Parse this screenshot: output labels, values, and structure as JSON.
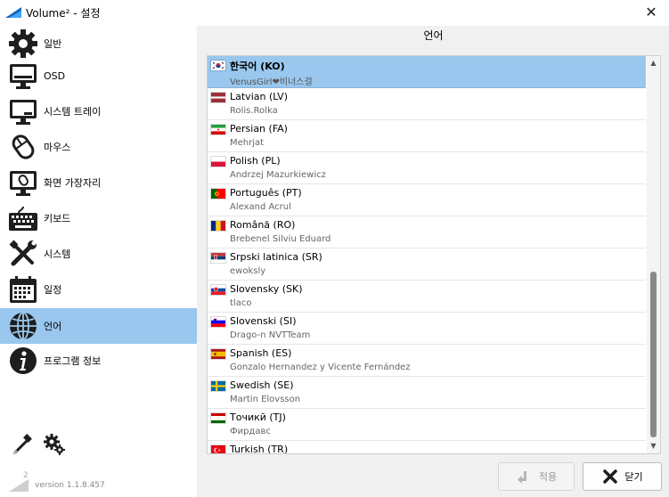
{
  "window": {
    "title": "Volume² - 설정",
    "close_glyph": "✕"
  },
  "sidebar": {
    "items": [
      {
        "label": "일반",
        "icon": "gear-icon"
      },
      {
        "label": "OSD",
        "icon": "monitor-icon"
      },
      {
        "label": "시스템 트레이",
        "icon": "tray-icon"
      },
      {
        "label": "마우스",
        "icon": "mouse-icon"
      },
      {
        "label": "화면 가장자리",
        "icon": "screen-edge-icon"
      },
      {
        "label": "키보드",
        "icon": "keyboard-icon"
      },
      {
        "label": "시스템",
        "icon": "tools-icon"
      },
      {
        "label": "일정",
        "icon": "calendar-icon"
      },
      {
        "label": "언어",
        "icon": "globe-icon"
      },
      {
        "label": "프로그램 정보",
        "icon": "info-icon"
      }
    ],
    "active_index": 8,
    "version_text": "version 1.1.8.457",
    "version_badge": "2"
  },
  "main": {
    "title": "언어",
    "languages": [
      {
        "name": "한국어 (KO)",
        "author": "VenusGirl❤비너스걸",
        "flag": "kr"
      },
      {
        "name": "Latvian (LV)",
        "author": "Rolis.Rolka",
        "flag": "lv"
      },
      {
        "name": "Persian (FA)",
        "author": "Mehrjat",
        "flag": "ir"
      },
      {
        "name": "Polish (PL)",
        "author": "Andrzej Mazurkiewicz",
        "flag": "pl"
      },
      {
        "name": "Português (PT)",
        "author": "Alexand Acrul",
        "flag": "pt"
      },
      {
        "name": "Română (RO)",
        "author": "Brebenel Silviu Eduard",
        "flag": "ro"
      },
      {
        "name": "Srpski latinica (SR)",
        "author": "ewoksly",
        "flag": "rs"
      },
      {
        "name": "Slovensky (SK)",
        "author": "tlaco",
        "flag": "sk"
      },
      {
        "name": "Slovenski (SI)",
        "author": "Drago-n NVTTeam",
        "flag": "si"
      },
      {
        "name": "Spanish (ES)",
        "author": "Gonzalo Hernandez y Vicente Fernández",
        "flag": "es"
      },
      {
        "name": "Swedish (SE)",
        "author": "Martin Elovsson",
        "flag": "se"
      },
      {
        "name": "Точикӣ (TJ)",
        "author": "Фирдавс",
        "flag": "tj"
      },
      {
        "name": "Turkish (TR)",
        "author": "",
        "flag": "tr"
      }
    ],
    "selected_index": 0
  },
  "buttons": {
    "apply_label": "적용",
    "close_label": "닫기"
  },
  "colors": {
    "selection": "#99c7ee",
    "sidebar_bg": "#ffffff",
    "window_bg": "#f0f0f0"
  }
}
